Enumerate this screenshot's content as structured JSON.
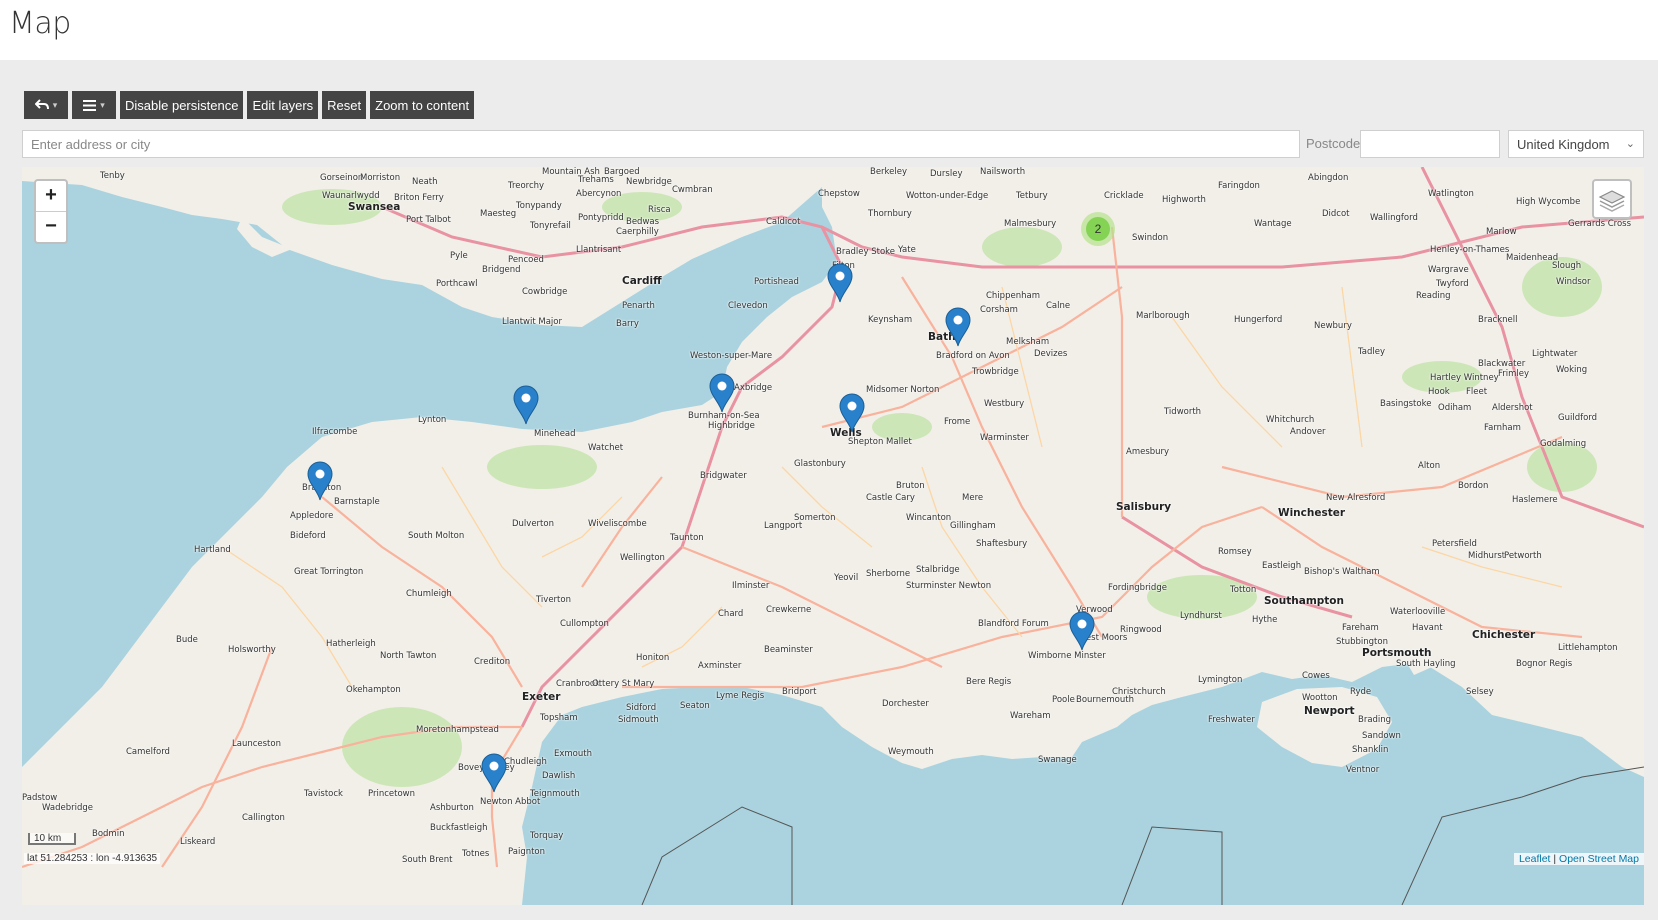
{
  "page": {
    "title": "Map"
  },
  "toolbar": {
    "undo_icon": "undo-arrow-icon",
    "menu_icon": "hamburger-menu-icon",
    "caret": "▾",
    "disable_persistence": "Disable persistence",
    "edit_layers": "Edit layers",
    "reset": "Reset",
    "zoom_to_content": "Zoom to content"
  },
  "search": {
    "address_placeholder": "Enter address or city",
    "postcode_label": "Postcode",
    "postcode_value": "",
    "country": "United Kingdom"
  },
  "map": {
    "zoom_in": "+",
    "zoom_out": "−",
    "scale": "10 km",
    "coordinates": "lat 51.284253 : lon -4.913635",
    "attribution_leaflet": "Leaflet",
    "attribution_sep": " | ",
    "attribution_osm": "Open Street Map",
    "colors": {
      "water": "#aad3df",
      "land": "#f2efe9",
      "marker": "#2a81cb",
      "cluster": "#6ecc39"
    },
    "markers": [
      {
        "name": "Bristol"
      },
      {
        "name": "Bradford on Avon"
      },
      {
        "name": "Minehead"
      },
      {
        "name": "Burnham-on-Sea"
      },
      {
        "name": "Shepton Mallet"
      },
      {
        "name": "Barnstaple"
      },
      {
        "name": "Wimborne Minster"
      },
      {
        "name": "Newton Abbot"
      }
    ],
    "cluster": {
      "count": "2",
      "near": "Swindon"
    },
    "places": [
      "Tenby",
      "Gorseinon",
      "Morriston",
      "Neath",
      "Mountain Ash",
      "Bargoed",
      "Berkeley",
      "Dursley",
      "Nailsworth",
      "Faringdon",
      "Abingdon",
      "Waunarlwydd",
      "Briton Ferry",
      "Treorchy",
      "Trehams",
      "Newbridge",
      "Cwmbran",
      "Chepstow",
      "Wotton-under-Edge",
      "Tetbury",
      "Cricklade",
      "Highworth",
      "Watlington",
      "High Wycombe",
      "Swansea",
      "Port Talbot",
      "Maesteg",
      "Tonypandy",
      "Abercynon",
      "Risca",
      "Newport",
      "Caldicot",
      "Thornbury",
      "Malmesbury",
      "Didcot",
      "Wallingford",
      "Gerrards Cross",
      "Tonyrefail",
      "Pontypridd",
      "Bedwas",
      "Caerphilly",
      "Yate",
      "Bradley Stoke",
      "Filton",
      "Swindon",
      "Wantage",
      "Marlow",
      "Henley-on-Thames",
      "Maidenhead",
      "Slough",
      "Pyle",
      "Pencoed",
      "Llantrisant",
      "Cardiff",
      "Bridgend",
      "Portishead",
      "Chippenham",
      "Calne",
      "Wargrave",
      "Twyford",
      "Windsor",
      "Porthcawl",
      "Cowbridge",
      "Penarth",
      "Clevedon",
      "Keynsham",
      "Corsham",
      "Melksham",
      "Marlborough",
      "Hungerford",
      "Reading",
      "Newbury",
      "Bracknell",
      "Llantwit Major",
      "Barry",
      "Bath",
      "Bradford on Avon",
      "Devizes",
      "Tadley",
      "Lightwater",
      "Blackwater",
      "Frimley",
      "Woking",
      "Weston-super-Mare",
      "Axbridge",
      "Midsomer Norton",
      "Trowbridge",
      "Hartley Wintney",
      "Hook",
      "Fleet",
      "Basingstoke",
      "Odiham",
      "Aldershot",
      "Lynton",
      "Minehead",
      "Watchet",
      "Burnham-on-Sea",
      "Highbridge",
      "Wells",
      "Shepton Mallet",
      "Frome",
      "Westbury",
      "Warminster",
      "Tidworth",
      "Whitchurch",
      "Andover",
      "Farnham",
      "Guildford",
      "Ilfracombe",
      "Glastonbury",
      "Amesbury",
      "Godalming",
      "Braunton",
      "Barnstaple",
      "Bridgwater",
      "Bruton",
      "Castle Cary",
      "Mere",
      "Salisbury",
      "Alton",
      "Bordon",
      "Haslemere",
      "Appledore",
      "Bideford",
      "Dulverton",
      "Wiveliscombe",
      "Somerton",
      "Langport",
      "Wincanton",
      "Gillingham",
      "Winchester",
      "New Alresford",
      "Hartland",
      "South Molton",
      "Taunton",
      "Wellington",
      "Shaftesbury",
      "Romsey",
      "Petersfield",
      "Midhurst",
      "Petworth",
      "Great Torrington",
      "Sherborne",
      "Stalbridge",
      "Eastleigh",
      "Bishop's Waltham",
      "Tiverton",
      "Ilminster",
      "Yeovil",
      "Sturminster Newton",
      "Fordingbridge",
      "Totton",
      "Southampton",
      "Chumleigh",
      "Crewkerne",
      "Chard",
      "Verwood",
      "Lyndhurst",
      "Hythe",
      "Fareham",
      "Waterlooville",
      "Havant",
      "Chichester",
      "Bude",
      "Holsworthy",
      "Hatherleigh",
      "Cullompton",
      "Beaminster",
      "Blandford Forum",
      "Ringwood",
      "Stubbington",
      "Portsmouth",
      "South Hayling",
      "Littlehampton",
      "North Tawton",
      "Crediton",
      "Honiton",
      "Axminster",
      "Wimborne Minster",
      "West Moors",
      "Bognor Regis",
      "Okehampton",
      "Exeter",
      "Cranbrook",
      "Ottery St Mary",
      "Lyme Regis",
      "Bridport",
      "Dorchester",
      "Bere Regis",
      "Christchurch",
      "Lymington",
      "Cowes",
      "Selsey",
      "Sidford",
      "Sidmouth",
      "Seaton",
      "Poole",
      "Bournemouth",
      "Wootton",
      "Ryde",
      "Newport",
      "Freshwater",
      "Brading",
      "Moretonhampstead",
      "Topsham",
      "Wareham",
      "Sandown",
      "Launceston",
      "Exmouth",
      "Weymouth",
      "Swanage",
      "Shanklin",
      "Camelford",
      "Bovey Tracey",
      "Chudleigh",
      "Dawlish",
      "Ventnor",
      "Tavistock",
      "Princetown",
      "Teignmouth",
      "Ashburton",
      "Newton Abbot",
      "Padstow",
      "Wadebridge",
      "Callington",
      "Buckfastleigh",
      "Bodmin",
      "Liskeard",
      "Torquay",
      "South Brent",
      "Totnes",
      "Paignton"
    ]
  }
}
